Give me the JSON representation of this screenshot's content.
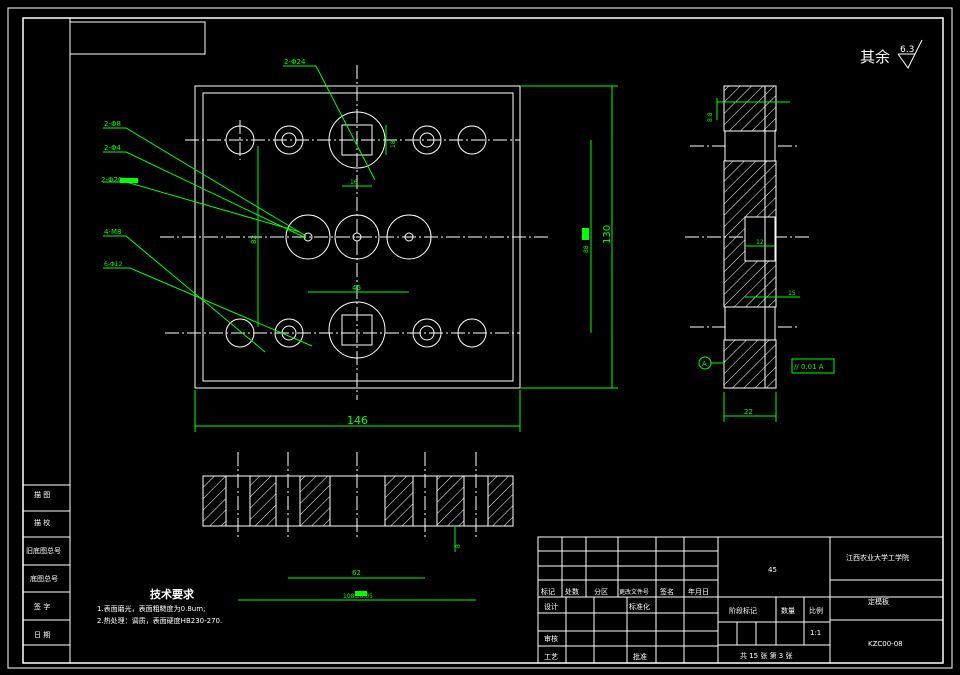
{
  "colors": {
    "background": "#000000",
    "lines": "#ffffff",
    "dimensions": "#00ff00"
  },
  "roughness_note": {
    "label": "其余",
    "value": "6.3"
  },
  "dimensions": {
    "top_024": "2-Φ24",
    "left_1": "2-Φ8",
    "left_2": "2-Φ4",
    "left_3": "2-Φ20",
    "left_4": "4-M8",
    "left_5": "6-Φ12",
    "w_146": "146",
    "h_130": "130",
    "inner_82": "82",
    "inner_46": "46",
    "sq_18": "18",
    "sq_16": "16",
    "right_small": "88",
    "side_8": "8.8",
    "side_12": "12",
    "side_22": "22",
    "side_15": "15",
    "datum": "A",
    "tol_frame": "// 0.01 A",
    "sec_8": "8",
    "sec_62": "62",
    "sec_108": "108±0.05"
  },
  "tech_requirements": {
    "title": "技术要求",
    "line1": "1.表面磨光，表面粗糙度为0.8um;",
    "line2": "2.热处理：调质，表面硬度HB230-270."
  },
  "left_strip": [
    "描 图",
    "描 校",
    "旧底图总号",
    "底图总号",
    "签 字",
    "日 期"
  ],
  "title_block": {
    "material": "45",
    "school": "江西农业大学工学院",
    "part_name": "定模板",
    "drawing_no": "KZC00-08",
    "scale_label": "比例",
    "scale": "1:1",
    "weight_label": "数量",
    "stage_label": "阶段标记",
    "sheets": "共 15 张  第 3 张",
    "rev_headers": [
      "标记",
      "处数",
      "分区",
      "更改文件号",
      "签名",
      "年月日"
    ],
    "roles": [
      "设计",
      "标准化",
      "审核",
      "工艺",
      "批准"
    ]
  }
}
